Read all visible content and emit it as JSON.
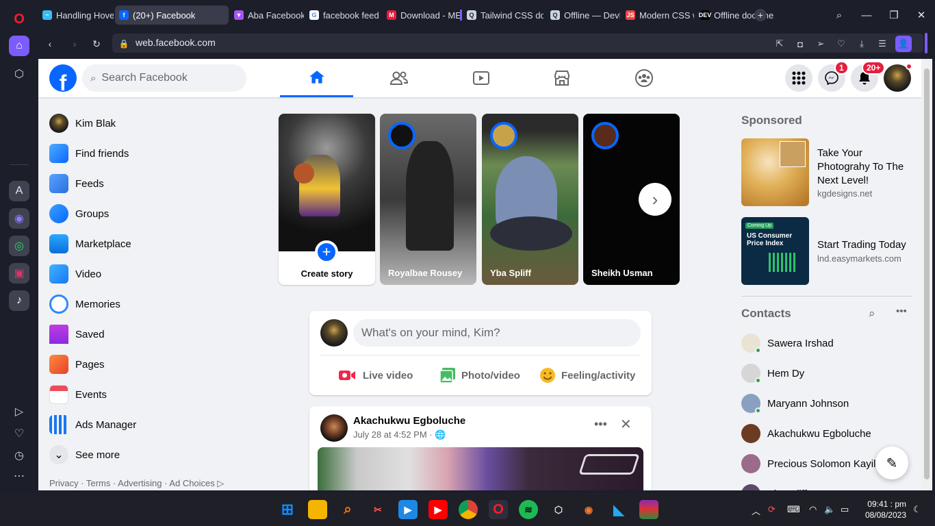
{
  "browser": {
    "tabs": [
      {
        "label": "Handling Hover",
        "color": "#38bdf8",
        "glyph": "~"
      },
      {
        "label": "(20+) Facebook",
        "color": "#0866ff",
        "glyph": "f",
        "active": true
      },
      {
        "label": "Aba Facebook",
        "color": "#a855f7",
        "glyph": "▼"
      },
      {
        "label": "facebook feed g",
        "color": "#ffffff",
        "glyph": "G"
      },
      {
        "label": "Download - ME",
        "color": "#e41e3f",
        "glyph": "M"
      },
      {
        "label": "Tailwind CSS do",
        "color": "#cbd5e1",
        "glyph": "Q"
      },
      {
        "label": "Offline — DevD",
        "color": "#cbd5e1",
        "glyph": "Q"
      },
      {
        "label": "Modern CSS wi",
        "color": "#ef4444",
        "glyph": "JS"
      },
      {
        "label": "Offline docume",
        "color": "#000000",
        "glyph": "DEV"
      }
    ],
    "url": "web.facebook.com"
  },
  "fb": {
    "search_placeholder": "Search Facebook",
    "messenger_badge": "1",
    "notif_badge": "20+",
    "nav_items": [
      {
        "label": "Kim Blak",
        "icon": "profile-avatar"
      },
      {
        "label": "Find friends",
        "icon": "friends-icon"
      },
      {
        "label": "Feeds",
        "icon": "feeds-icon"
      },
      {
        "label": "Groups",
        "icon": "groups-icon"
      },
      {
        "label": "Marketplace",
        "icon": "marketplace-icon"
      },
      {
        "label": "Video",
        "icon": "video-icon"
      },
      {
        "label": "Memories",
        "icon": "memories-icon"
      },
      {
        "label": "Saved",
        "icon": "saved-icon"
      },
      {
        "label": "Pages",
        "icon": "pages-icon"
      },
      {
        "label": "Events",
        "icon": "events-icon"
      },
      {
        "label": "Ads Manager",
        "icon": "ads-manager-icon"
      },
      {
        "label": "See more",
        "icon": "chevron-down-icon"
      }
    ],
    "footer": "Privacy · Terms · Advertising · Ad Choices ▷",
    "stories": {
      "create_label": "Create story",
      "items": [
        {
          "name": "Royalbae Rousey"
        },
        {
          "name": "Yba Spliff"
        },
        {
          "name": "Sheikh Usman"
        }
      ]
    },
    "composer": {
      "placeholder": "What's on your mind, Kim?",
      "live": "Live video",
      "photo": "Photo/video",
      "feeling": "Feeling/activity"
    },
    "post": {
      "author": "Akachukwu Egboluche",
      "time": "July 28 at 4:52 PM · 🌐"
    },
    "sponsored": {
      "title": "Sponsored",
      "ads": [
        {
          "headline": "Take Your Photograhy To The Next Level!",
          "domain": "kgdesigns.net"
        },
        {
          "headline": "Start Trading Today",
          "domain": "lnd.easymarkets.com",
          "image_title": "US Consumer Price Index",
          "image_tag": "Coming Up"
        }
      ]
    },
    "contacts": {
      "title": "Contacts",
      "items": [
        {
          "name": "Sawera Irshad",
          "online": true
        },
        {
          "name": "Hem Dy",
          "online": true
        },
        {
          "name": "Maryann Johnson",
          "online": true
        },
        {
          "name": "Akachukwu Egboluche",
          "online": false
        },
        {
          "name": "Precious Solomon Kayili",
          "online": false
        },
        {
          "name": "Vic Spliff",
          "online": false
        }
      ]
    }
  },
  "taskbar": {
    "time": "09:41 : pm",
    "date": "08/08/2023"
  }
}
